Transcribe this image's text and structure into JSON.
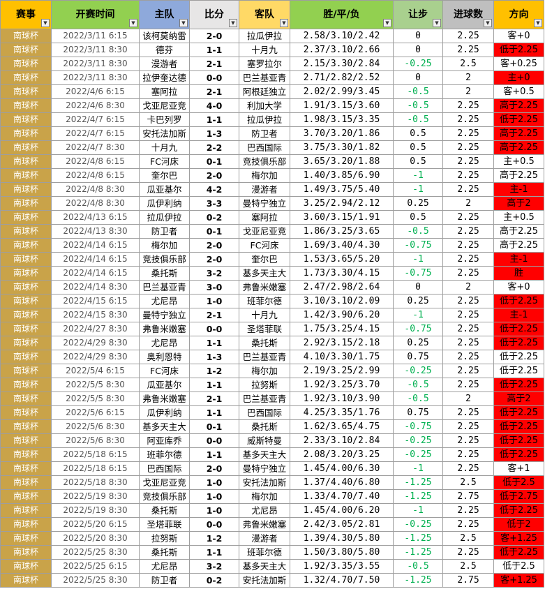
{
  "headers": {
    "league": "赛事",
    "time": "开赛时间",
    "home": "主队",
    "score": "比分",
    "away": "客队",
    "odds": "胜/平/负",
    "handicap": "让步",
    "goals": "进球数",
    "direction": "方向"
  },
  "colors": {
    "highlight": "#ff0000",
    "league_cell": "#c9a349",
    "negative_handicap": "#00b050"
  },
  "rows": [
    {
      "league": "南球杯",
      "time": "2022/3/11 6:15",
      "home": "该柯莫纳雷",
      "score": "2-0",
      "away": "拉瓜伊拉",
      "odds": "2.58/3.10/2.42",
      "handicap": "0",
      "goals": "2.25",
      "direction": "客+0",
      "highlight": false
    },
    {
      "league": "南球杯",
      "time": "2022/3/11 8:30",
      "home": "德芬",
      "score": "1-1",
      "away": "十月九",
      "odds": "2.37/3.10/2.66",
      "handicap": "0",
      "goals": "2.25",
      "direction": "低于2.25",
      "highlight": true
    },
    {
      "league": "南球杯",
      "time": "2022/3/11 8:30",
      "home": "漫游者",
      "score": "2-1",
      "away": "塞罗拉尔",
      "odds": "2.15/3.30/2.84",
      "handicap": "-0.25",
      "goals": "2.5",
      "direction": "客+0.25",
      "highlight": false
    },
    {
      "league": "南球杯",
      "time": "2022/3/11 8:30",
      "home": "拉伊奎达德",
      "score": "0-0",
      "away": "巴兰基亚青",
      "odds": "2.71/2.82/2.52",
      "handicap": "0",
      "goals": "2",
      "direction": "主+0",
      "highlight": true
    },
    {
      "league": "南球杯",
      "time": "2022/4/6 6:15",
      "home": "塞阿拉",
      "score": "2-1",
      "away": "阿根廷独立",
      "odds": "2.02/2.99/3.45",
      "handicap": "-0.5",
      "goals": "2",
      "direction": "客+0.5",
      "highlight": false
    },
    {
      "league": "南球杯",
      "time": "2022/4/6 8:30",
      "home": "戈亚尼亚竞",
      "score": "4-0",
      "away": "利加大学",
      "odds": "1.91/3.15/3.60",
      "handicap": "-0.5",
      "goals": "2.25",
      "direction": "高于2.25",
      "highlight": true
    },
    {
      "league": "南球杯",
      "time": "2022/4/7 6:15",
      "home": "卡巴列罗",
      "score": "1-1",
      "away": "拉瓜伊拉",
      "odds": "1.98/3.15/3.35",
      "handicap": "-0.5",
      "goals": "2.25",
      "direction": "低于2.25",
      "highlight": true
    },
    {
      "league": "南球杯",
      "time": "2022/4/7 6:15",
      "home": "安托法加斯",
      "score": "1-3",
      "away": "防卫者",
      "odds": "3.70/3.20/1.86",
      "handicap": "0.5",
      "goals": "2.25",
      "direction": "高于2.25",
      "highlight": true
    },
    {
      "league": "南球杯",
      "time": "2022/4/7 8:30",
      "home": "十月九",
      "score": "2-2",
      "away": "巴西国际",
      "odds": "3.75/3.30/1.82",
      "handicap": "0.5",
      "goals": "2.25",
      "direction": "高于2.25",
      "highlight": true
    },
    {
      "league": "南球杯",
      "time": "2022/4/8 6:15",
      "home": "FC河床",
      "score": "0-1",
      "away": "竞技俱乐部",
      "odds": "3.65/3.20/1.88",
      "handicap": "0.5",
      "goals": "2.25",
      "direction": "主+0.5",
      "highlight": false
    },
    {
      "league": "南球杯",
      "time": "2022/4/8 6:15",
      "home": "奎尔巴",
      "score": "2-0",
      "away": "梅尔加",
      "odds": "1.40/3.85/6.90",
      "handicap": "-1",
      "goals": "2.25",
      "direction": "高于2.25",
      "highlight": false
    },
    {
      "league": "南球杯",
      "time": "2022/4/8 8:30",
      "home": "瓜亚基尔",
      "score": "4-2",
      "away": "漫游者",
      "odds": "1.49/3.75/5.40",
      "handicap": "-1",
      "goals": "2.25",
      "direction": "主-1",
      "highlight": true
    },
    {
      "league": "南球杯",
      "time": "2022/4/8 8:30",
      "home": "瓜伊利纳",
      "score": "3-3",
      "away": "曼特宁独立",
      "odds": "3.25/2.94/2.12",
      "handicap": "0.25",
      "goals": "2",
      "direction": "高于2",
      "highlight": true
    },
    {
      "league": "南球杯",
      "time": "2022/4/13 6:15",
      "home": "拉瓜伊拉",
      "score": "0-2",
      "away": "塞阿拉",
      "odds": "3.60/3.15/1.91",
      "handicap": "0.5",
      "goals": "2.25",
      "direction": "主+0.5",
      "highlight": false
    },
    {
      "league": "南球杯",
      "time": "2022/4/13 8:30",
      "home": "防卫者",
      "score": "0-1",
      "away": "戈亚尼亚竞",
      "odds": "1.86/3.25/3.65",
      "handicap": "-0.5",
      "goals": "2.25",
      "direction": "高于2.25",
      "highlight": false
    },
    {
      "league": "南球杯",
      "time": "2022/4/14 6:15",
      "home": "梅尔加",
      "score": "2-0",
      "away": "FC河床",
      "odds": "1.69/3.40/4.30",
      "handicap": "-0.75",
      "goals": "2.25",
      "direction": "高于2.25",
      "highlight": false
    },
    {
      "league": "南球杯",
      "time": "2022/4/14 6:15",
      "home": "竞技俱乐部",
      "score": "2-0",
      "away": "奎尔巴",
      "odds": "1.53/3.65/5.20",
      "handicap": "-1",
      "goals": "2.25",
      "direction": "主-1",
      "highlight": true
    },
    {
      "league": "南球杯",
      "time": "2022/4/14 6:15",
      "home": "桑托斯",
      "score": "3-2",
      "away": "基多天主大",
      "odds": "1.73/3.30/4.15",
      "handicap": "-0.75",
      "goals": "2.25",
      "direction": "胜",
      "highlight": true
    },
    {
      "league": "南球杯",
      "time": "2022/4/14 8:30",
      "home": "巴兰基亚青",
      "score": "3-0",
      "away": "弗鲁米嫩塞",
      "odds": "2.47/2.98/2.64",
      "handicap": "0",
      "goals": "2",
      "direction": "客+0",
      "highlight": false
    },
    {
      "league": "南球杯",
      "time": "2022/4/15 6:15",
      "home": "尤尼昂",
      "score": "1-0",
      "away": "班菲尔德",
      "odds": "3.10/3.10/2.09",
      "handicap": "0.25",
      "goals": "2.25",
      "direction": "低于2.25",
      "highlight": true
    },
    {
      "league": "南球杯",
      "time": "2022/4/15 8:30",
      "home": "曼特宁独立",
      "score": "2-1",
      "away": "十月九",
      "odds": "1.42/3.90/6.20",
      "handicap": "-1",
      "goals": "2.25",
      "direction": "主-1",
      "highlight": true
    },
    {
      "league": "南球杯",
      "time": "2022/4/27 8:30",
      "home": "弗鲁米嫩塞",
      "score": "0-0",
      "away": "圣塔菲联",
      "odds": "1.75/3.25/4.15",
      "handicap": "-0.75",
      "goals": "2.25",
      "direction": "低于2.25",
      "highlight": true
    },
    {
      "league": "南球杯",
      "time": "2022/4/29 8:30",
      "home": "尤尼昂",
      "score": "1-1",
      "away": "桑托斯",
      "odds": "2.92/3.15/2.18",
      "handicap": "0.25",
      "goals": "2.25",
      "direction": "低于2.25",
      "highlight": true
    },
    {
      "league": "南球杯",
      "time": "2022/4/29 8:30",
      "home": "奥利恩特",
      "score": "1-3",
      "away": "巴兰基亚青",
      "odds": "4.10/3.30/1.75",
      "handicap": "0.75",
      "goals": "2.25",
      "direction": "低于2.25",
      "highlight": false
    },
    {
      "league": "南球杯",
      "time": "2022/5/4 6:15",
      "home": "FC河床",
      "score": "1-2",
      "away": "梅尔加",
      "odds": "2.19/3.25/2.99",
      "handicap": "-0.25",
      "goals": "2.25",
      "direction": "低于2.25",
      "highlight": false
    },
    {
      "league": "南球杯",
      "time": "2022/5/5 8:30",
      "home": "瓜亚基尔",
      "score": "1-1",
      "away": "拉努斯",
      "odds": "1.92/3.25/3.70",
      "handicap": "-0.5",
      "goals": "2.25",
      "direction": "低于2.25",
      "highlight": true
    },
    {
      "league": "南球杯",
      "time": "2022/5/5 8:30",
      "home": "弗鲁米嫩塞",
      "score": "2-1",
      "away": "巴兰基亚青",
      "odds": "1.92/3.10/3.90",
      "handicap": "-0.5",
      "goals": "2",
      "direction": "高于2",
      "highlight": true
    },
    {
      "league": "南球杯",
      "time": "2022/5/6 6:15",
      "home": "瓜伊利纳",
      "score": "1-1",
      "away": "巴西国际",
      "odds": "4.25/3.35/1.76",
      "handicap": "0.75",
      "goals": "2.25",
      "direction": "低于2.25",
      "highlight": true
    },
    {
      "league": "南球杯",
      "time": "2022/5/6 8:30",
      "home": "基多天主大",
      "score": "0-1",
      "away": "桑托斯",
      "odds": "1.62/3.65/4.75",
      "handicap": "-0.75",
      "goals": "2.25",
      "direction": "低于2.25",
      "highlight": true
    },
    {
      "league": "南球杯",
      "time": "2022/5/6 8:30",
      "home": "阿亚库乔",
      "score": "0-0",
      "away": "威斯特曼",
      "odds": "2.33/3.10/2.84",
      "handicap": "-0.25",
      "goals": "2.25",
      "direction": "低于2.25",
      "highlight": true
    },
    {
      "league": "南球杯",
      "time": "2022/5/18 6:15",
      "home": "班菲尔德",
      "score": "1-1",
      "away": "基多天主大",
      "odds": "2.08/3.20/3.25",
      "handicap": "-0.25",
      "goals": "2.25",
      "direction": "低于2.25",
      "highlight": true
    },
    {
      "league": "南球杯",
      "time": "2022/5/18 6:15",
      "home": "巴西国际",
      "score": "2-0",
      "away": "曼特宁独立",
      "odds": "1.45/4.00/6.30",
      "handicap": "-1",
      "goals": "2.25",
      "direction": "客+1",
      "highlight": false
    },
    {
      "league": "南球杯",
      "time": "2022/5/18 8:30",
      "home": "戈亚尼亚竞",
      "score": "1-0",
      "away": "安托法加斯",
      "odds": "1.37/4.40/6.80",
      "handicap": "-1.25",
      "goals": "2.5",
      "direction": "低于2.5",
      "highlight": true
    },
    {
      "league": "南球杯",
      "time": "2022/5/19 8:30",
      "home": "竞技俱乐部",
      "score": "1-0",
      "away": "梅尔加",
      "odds": "1.33/4.70/7.40",
      "handicap": "-1.25",
      "goals": "2.75",
      "direction": "低于2.75",
      "highlight": true
    },
    {
      "league": "南球杯",
      "time": "2022/5/19 8:30",
      "home": "桑托斯",
      "score": "1-0",
      "away": "尤尼昂",
      "odds": "1.45/4.00/6.20",
      "handicap": "-1",
      "goals": "2.25",
      "direction": "低于2.25",
      "highlight": true
    },
    {
      "league": "南球杯",
      "time": "2022/5/20 6:15",
      "home": "圣塔菲联",
      "score": "0-0",
      "away": "弗鲁米嫩塞",
      "odds": "2.42/3.05/2.81",
      "handicap": "-0.25",
      "goals": "2.25",
      "direction": "低于2",
      "highlight": true
    },
    {
      "league": "南球杯",
      "time": "2022/5/20 8:30",
      "home": "拉努斯",
      "score": "1-2",
      "away": "漫游者",
      "odds": "1.39/4.30/5.80",
      "handicap": "-1.25",
      "goals": "2.5",
      "direction": "客+1.25",
      "highlight": true
    },
    {
      "league": "南球杯",
      "time": "2022/5/25 8:30",
      "home": "桑托斯",
      "score": "1-1",
      "away": "班菲尔德",
      "odds": "1.50/3.80/5.80",
      "handicap": "-1.25",
      "goals": "2.25",
      "direction": "低于2.25",
      "highlight": true
    },
    {
      "league": "南球杯",
      "time": "2022/5/25 6:15",
      "home": "尤尼昂",
      "score": "3-2",
      "away": "基多天主大",
      "odds": "1.92/3.35/3.55",
      "handicap": "-0.5",
      "goals": "2.5",
      "direction": "低于2.5",
      "highlight": false
    },
    {
      "league": "南球杯",
      "time": "2022/5/25 8:30",
      "home": "防卫者",
      "score": "0-2",
      "away": "安托法加斯",
      "odds": "1.32/4.70/7.50",
      "handicap": "-1.25",
      "goals": "2.75",
      "direction": "客+1.25",
      "highlight": true
    }
  ]
}
